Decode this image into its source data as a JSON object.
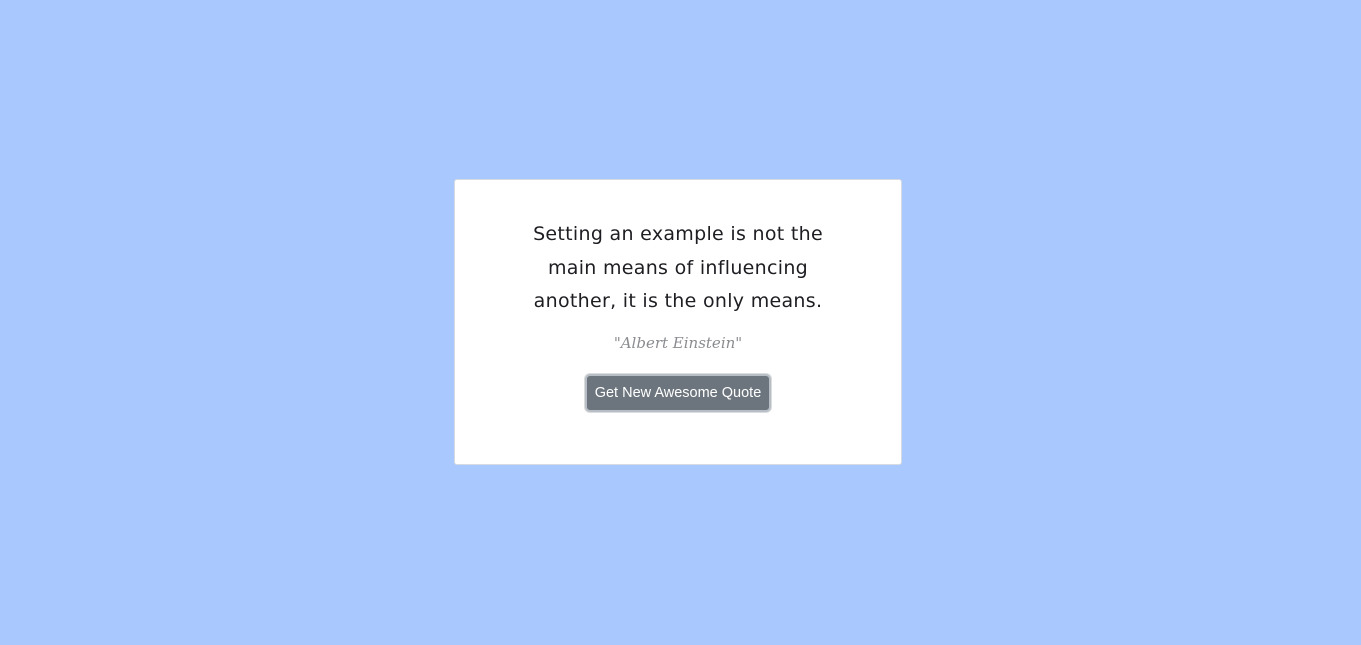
{
  "quote": {
    "text": "Setting an example is not the main means of influencing another, it is the only means.",
    "author": "\"Albert Einstein\""
  },
  "actions": {
    "new_quote_label": "Get New Awesome Quote"
  },
  "colors": {
    "background": "#a9c8fe",
    "card": "#ffffff",
    "button": "#6c757d",
    "button_text": "#ffffff"
  }
}
